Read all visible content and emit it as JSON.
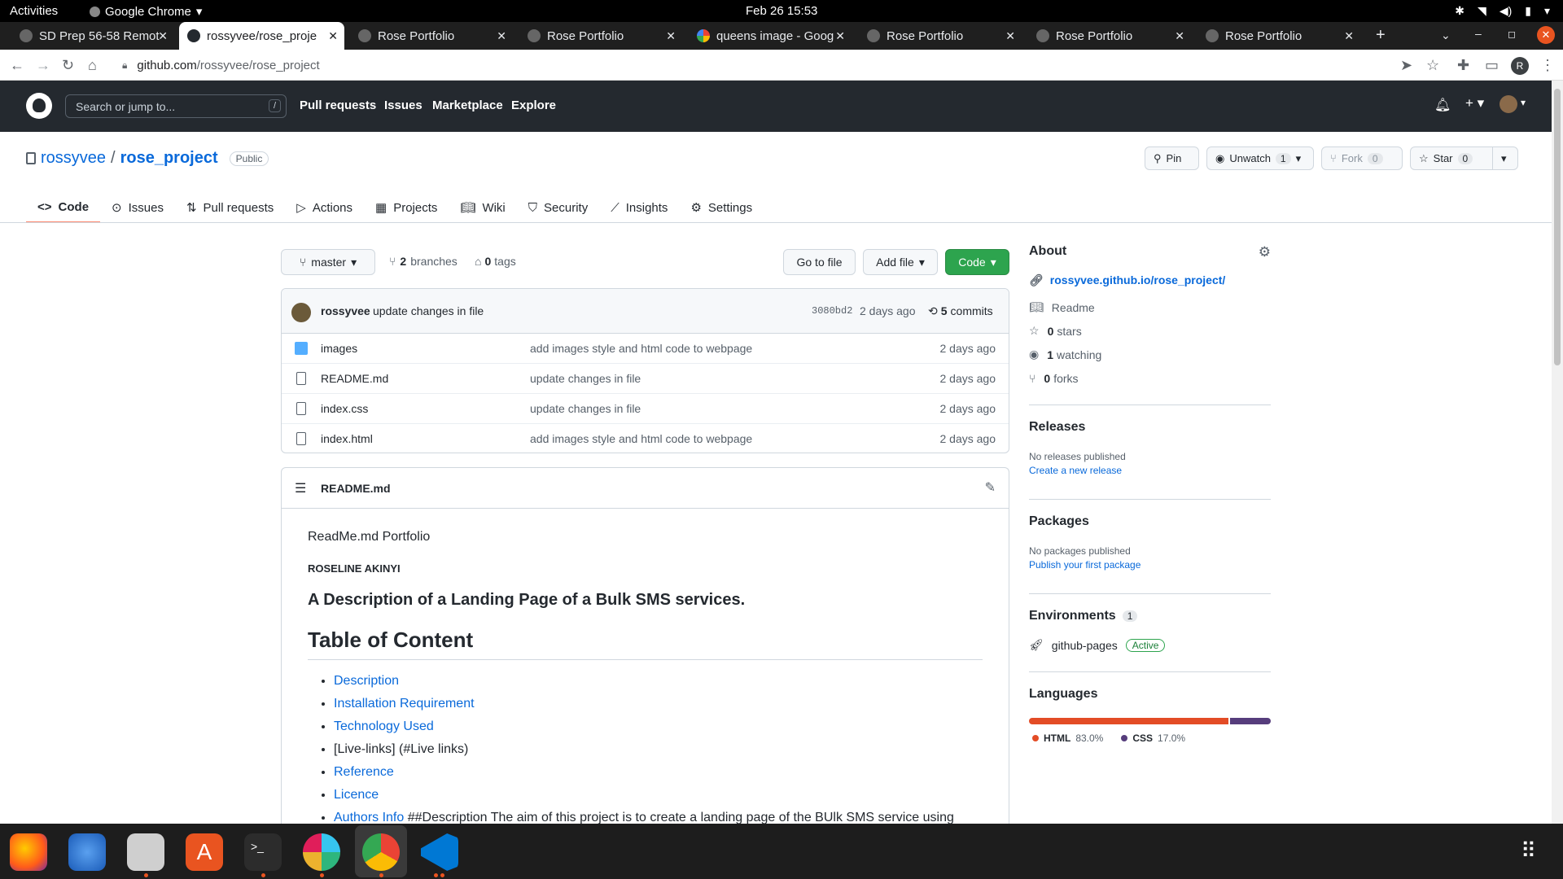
{
  "os_bar": {
    "activities": "Activities",
    "app": "Google Chrome",
    "clock": "Feb 26  15:53"
  },
  "browser": {
    "tabs": [
      {
        "title": "SD Prep 56-58 Remot",
        "active": false
      },
      {
        "title": "rossyvee/rose_proje",
        "active": true
      },
      {
        "title": "Rose Portfolio",
        "active": false
      },
      {
        "title": "Rose Portfolio",
        "active": false
      },
      {
        "title": "queens image - Goog",
        "active": false
      },
      {
        "title": "Rose Portfolio",
        "active": false
      },
      {
        "title": "Rose Portfolio",
        "active": false
      },
      {
        "title": "Rose Portfolio",
        "active": false
      }
    ],
    "url_host": "github.com",
    "url_path": "/rossyvee/rose_project",
    "profile_initial": "R"
  },
  "gh": {
    "search_placeholder": "Search or jump to...",
    "search_key": "/",
    "nav": [
      "Pull requests",
      "Issues",
      "Marketplace",
      "Explore"
    ]
  },
  "repo": {
    "owner": "rossyvee",
    "sep": "/",
    "name": "rose_project",
    "visibility": "Public",
    "pin": "Pin",
    "unwatch": "Unwatch",
    "unwatch_count": "1",
    "fork": "Fork",
    "fork_count": "0",
    "star": "Star",
    "star_count": "0",
    "tabs": [
      "Code",
      "Issues",
      "Pull requests",
      "Actions",
      "Projects",
      "Wiki",
      "Security",
      "Insights",
      "Settings"
    ]
  },
  "code": {
    "branch": "master",
    "branches_count": "2",
    "branches_label": "branches",
    "tags_count": "0",
    "tags_label": "tags",
    "go_to_file": "Go to file",
    "add_file": "Add file",
    "code_btn": "Code",
    "commit": {
      "author": "rossyvee",
      "message": "update changes in file",
      "sha": "3080bd2",
      "age": "2 days ago",
      "count": "5",
      "count_label": "commits"
    },
    "files": [
      {
        "name": "images",
        "type": "folder",
        "message": "add images style and html code to webpage",
        "age": "2 days ago"
      },
      {
        "name": "README.md",
        "type": "file",
        "message": "update changes in file",
        "age": "2 days ago"
      },
      {
        "name": "index.css",
        "type": "file",
        "message": "update changes in file",
        "age": "2 days ago"
      },
      {
        "name": "index.html",
        "type": "file",
        "message": "add images style and html code to webpage",
        "age": "2 days ago"
      }
    ]
  },
  "readme": {
    "filename": "README.md",
    "intro": "ReadMe.md Portfolio",
    "author": "ROSELINE AKINYI",
    "h2": "A Description of a Landing Page of a Bulk SMS services.",
    "h1": "Table of Content",
    "toc": [
      {
        "text": "Description",
        "link": true
      },
      {
        "text": "Installation Requirement",
        "link": true
      },
      {
        "text": "Technology Used",
        "link": true
      },
      {
        "text": "[Live-links] (#Live links)",
        "link": false
      },
      {
        "text": "Reference",
        "link": true
      },
      {
        "text": "Licence",
        "link": true
      }
    ],
    "last_link": "Authors Info",
    "last_text": " ##Description The aim of this project is to create a landing page of the BUlk SMS service using"
  },
  "about": {
    "title": "About",
    "website": "rossyvee.github.io/rose_project/",
    "readme": "Readme",
    "stars_n": "0",
    "stars": "stars",
    "watching_n": "1",
    "watching": "watching",
    "forks_n": "0",
    "forks": "forks"
  },
  "releases": {
    "title": "Releases",
    "none": "No releases published",
    "link": "Create a new release"
  },
  "packages": {
    "title": "Packages",
    "none": "No packages published",
    "link": "Publish your first package"
  },
  "environments": {
    "title": "Environments",
    "count": "1",
    "name": "github-pages",
    "status": "Active"
  },
  "languages": {
    "title": "Languages",
    "items": [
      {
        "name": "HTML",
        "percent": "83.0%",
        "value": 83.0,
        "color": "#e34c26"
      },
      {
        "name": "CSS",
        "percent": "17.0%",
        "value": 17.0,
        "color": "#563d7c"
      }
    ]
  }
}
